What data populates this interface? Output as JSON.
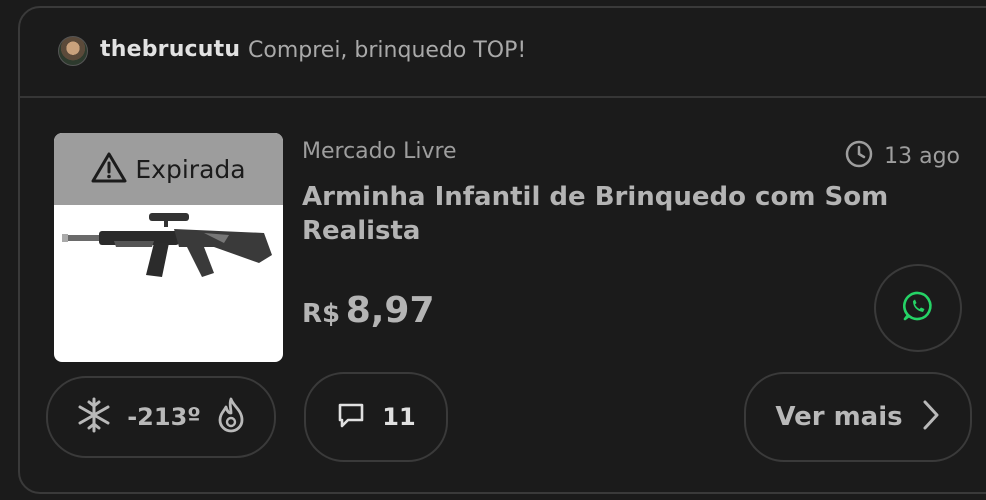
{
  "post": {
    "username": "thebrucutu",
    "comment": "Comprei, brinquedo TOP!"
  },
  "deal": {
    "status_badge": "Expirada",
    "store": "Mercado Livre",
    "time": "13 ago",
    "title": "Arminha Infantil de Brinquedo com Som Realista",
    "currency": "R$",
    "price": "8,97"
  },
  "actions": {
    "temperature": "-213º",
    "comment_count": "11",
    "more_label": "Ver mais"
  },
  "icons": {
    "avatar": "user-avatar",
    "warning": "warning-triangle-icon",
    "clock": "clock-icon",
    "whatsapp": "whatsapp-icon",
    "freeze": "snowflake-icon",
    "hot": "flame-icon",
    "comment": "comment-bubble-icon",
    "chevron": "chevron-right-icon"
  },
  "colors": {
    "background": "#1b1b1b",
    "border": "#3a3a3a",
    "expired_badge": "#9d9d9d",
    "whatsapp": "#25d366"
  }
}
